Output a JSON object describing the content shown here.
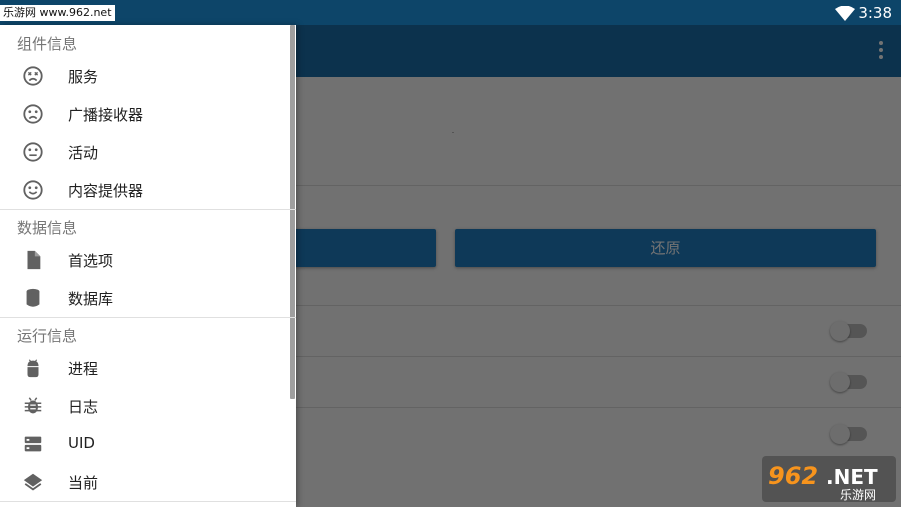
{
  "watermark_top": "乐游网 www.962.net",
  "status_bar": {
    "time": "3:38",
    "wifi_icon": "wifi-icon"
  },
  "app_bar": {
    "overflow_icon": "more-vert-icon"
  },
  "content": {
    "buttons": [
      {
        "label": ""
      },
      {
        "label": "还原"
      }
    ],
    "toggles": [
      {
        "checked": false
      },
      {
        "checked": false
      },
      {
        "checked": false
      }
    ]
  },
  "drawer": {
    "sections": [
      {
        "header": "组件信息",
        "items": [
          {
            "label": "服务",
            "icon": "dizzy-face-icon"
          },
          {
            "label": "广播接收器",
            "icon": "sad-face-icon"
          },
          {
            "label": "活动",
            "icon": "neutral-face-icon"
          },
          {
            "label": "内容提供器",
            "icon": "happy-face-icon"
          }
        ]
      },
      {
        "header": "数据信息",
        "items": [
          {
            "label": "首选项",
            "icon": "file-icon"
          },
          {
            "label": "数据库",
            "icon": "database-icon"
          }
        ]
      },
      {
        "header": "运行信息",
        "items": [
          {
            "label": "进程",
            "icon": "android-icon"
          },
          {
            "label": "日志",
            "icon": "bug-icon"
          },
          {
            "label": "UID",
            "icon": "server-icon"
          },
          {
            "label": "当前",
            "icon": "layers-icon"
          }
        ]
      }
    ]
  },
  "watermark_logo": {
    "text_main": "962.NET",
    "text_sub": "乐游网"
  }
}
